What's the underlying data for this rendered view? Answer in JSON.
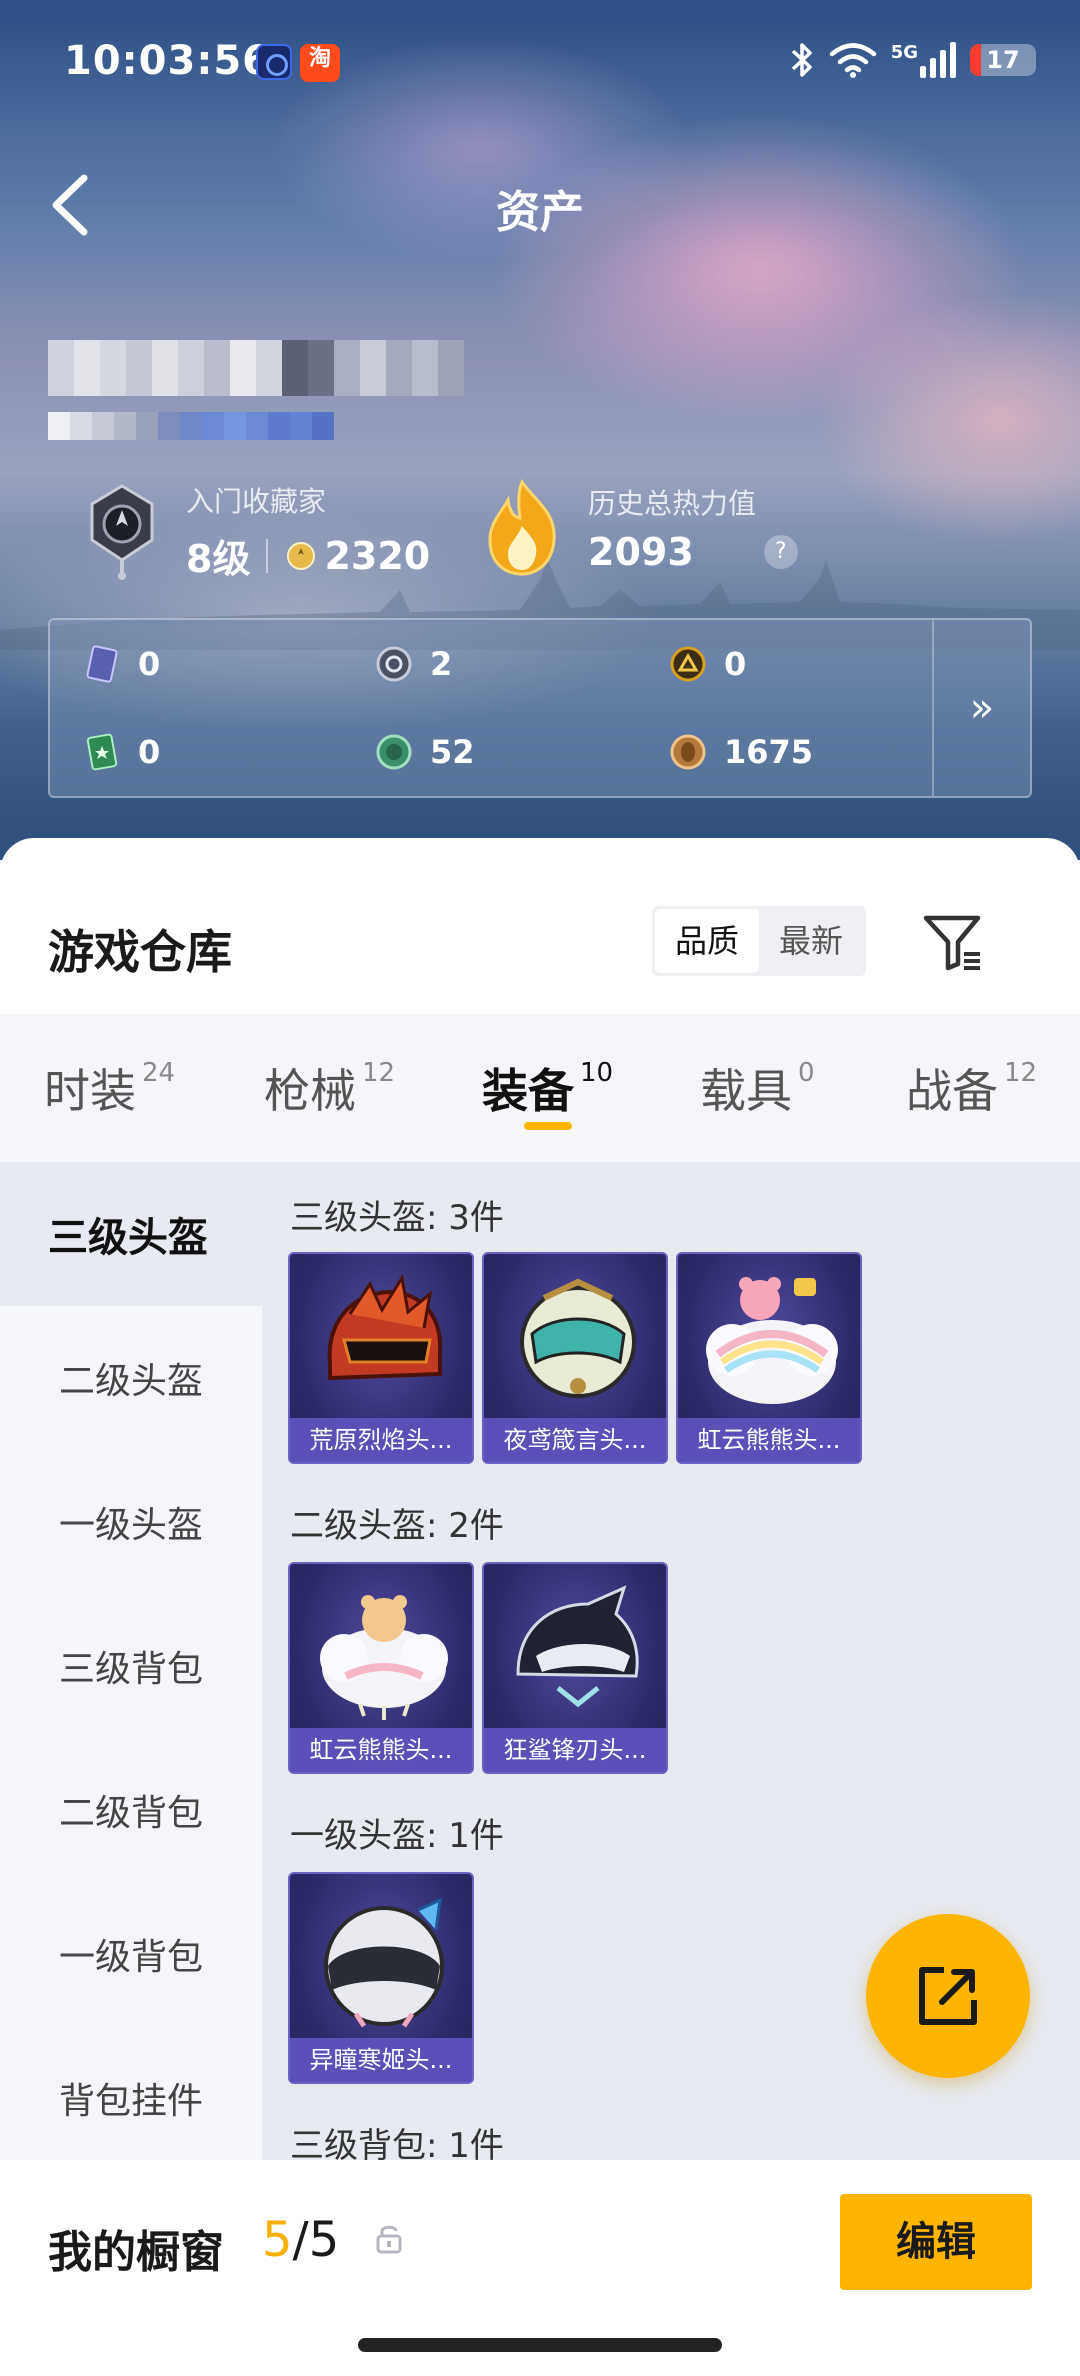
{
  "status_bar": {
    "time": "10:03:56",
    "app2_glyph": "淘",
    "network": "5G",
    "battery": "17",
    "battery_level": 0.17
  },
  "header": {
    "title": "资产",
    "back_icon": "chevron-left-icon"
  },
  "profile": {
    "rank_label": "入门收藏家",
    "rank_level": "8级",
    "rank_points": "2320",
    "heat_label": "历史总热力值",
    "heat_value": "2093",
    "help_glyph": "?"
  },
  "currencies": [
    {
      "icon": "card-icon",
      "value": "0",
      "color": "#5a5fb0"
    },
    {
      "icon": "silver-coin-icon",
      "value": "2",
      "color": "#9aa4b8"
    },
    {
      "icon": "gold-badge-icon",
      "value": "0",
      "color": "#d8a020"
    },
    {
      "icon": "green-card-icon",
      "value": "0",
      "color": "#2e8a52"
    },
    {
      "icon": "green-coin-icon",
      "value": "52",
      "color": "#3b8e6a"
    },
    {
      "icon": "bronze-coin-icon",
      "value": "1675",
      "color": "#b57a3c"
    }
  ],
  "currency_more": "»",
  "warehouse": {
    "title": "游戏仓库",
    "sort_options": [
      "品质",
      "最新"
    ],
    "sort_active": 0
  },
  "categories": [
    {
      "label": "时装",
      "count": "24"
    },
    {
      "label": "枪械",
      "count": "12"
    },
    {
      "label": "装备",
      "count": "10"
    },
    {
      "label": "载具",
      "count": "0"
    },
    {
      "label": "战备",
      "count": "12"
    }
  ],
  "active_category": 2,
  "sub_nav": [
    "三级头盔",
    "二级头盔",
    "一级头盔",
    "三级背包",
    "二级背包",
    "一级背包",
    "背包挂件"
  ],
  "groups": [
    {
      "title": "三级头盔: 3件",
      "items": [
        "荒原烈焰头...",
        "夜鸢箴言头...",
        "虹云熊熊头..."
      ]
    },
    {
      "title": "二级头盔: 2件",
      "items": [
        "虹云熊熊头...",
        "狂鲨锋刃头..."
      ]
    },
    {
      "title": "一级头盔: 1件",
      "items": [
        "异瞳寒姬头..."
      ]
    },
    {
      "title": "三级背包: 1件",
      "items": []
    }
  ],
  "showcase": {
    "label": "我的橱窗",
    "current": "5",
    "separator": "/",
    "total": "5",
    "edit_label": "编辑"
  },
  "colors": {
    "accent": "#ffb400",
    "card_bg": "#2d2a6b",
    "card_label_bg": "#5b4fb8"
  }
}
